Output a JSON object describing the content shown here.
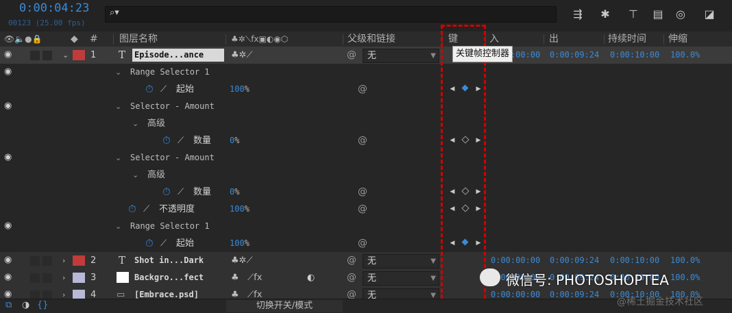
{
  "top": {
    "timecode": "0:00:04:23",
    "fps": "00123 (25.00 fps)",
    "search_placeholder": ""
  },
  "toolbar_icons": [
    "draft-3d-icon",
    "shape-icon",
    "frame-blend-icon",
    "graph-editor-icon",
    "motion-blur-icon",
    "composition-icon"
  ],
  "header": {
    "layer_name": "图层名称",
    "num": "#",
    "parent": "父级和链接",
    "key": "键",
    "in": "入",
    "out": "出",
    "duration": "持续时间",
    "stretch": "伸缩"
  },
  "tooltip": "关键帧控制器",
  "rows": [
    {
      "kind": "layer",
      "num": "1",
      "name": "Episode...ance",
      "color": "#c23b3b",
      "parent": "无",
      "in": "0:00:00:00",
      "out": "0:00:09:24",
      "dur": "0:00:10:00",
      "stretch": "100.0%"
    },
    {
      "kind": "group",
      "label": "Range Selector 1"
    },
    {
      "kind": "prop",
      "label": "起始",
      "value": "100",
      "unit": "%",
      "kf": "on"
    },
    {
      "kind": "group",
      "label": "Selector - Amount"
    },
    {
      "kind": "subgroup",
      "label": "高级"
    },
    {
      "kind": "prop",
      "label": "数量",
      "value": "0",
      "unit": "%",
      "kf": "off"
    },
    {
      "kind": "group",
      "label": "Selector - Amount"
    },
    {
      "kind": "subgroup",
      "label": "高级"
    },
    {
      "kind": "prop",
      "label": "数量",
      "value": "0",
      "unit": "%",
      "kf": "off"
    },
    {
      "kind": "prop",
      "label": "不透明度",
      "value": "100",
      "unit": "%",
      "kf": "off"
    },
    {
      "kind": "group",
      "label": "Range Selector 1"
    },
    {
      "kind": "prop",
      "label": "起始",
      "value": "100",
      "unit": "%",
      "kf": "on"
    },
    {
      "kind": "layer",
      "num": "2",
      "name": "Shot in...Dark",
      "color": "#c23b3b",
      "parent": "无",
      "in": "0:00:00:00",
      "out": "0:00:09:24",
      "dur": "0:00:10:00",
      "stretch": "100.0%"
    },
    {
      "kind": "layer",
      "num": "3",
      "name": "Backgro...fect",
      "color": "#b8b8d8",
      "parent": "无",
      "in": "0:00:00:00",
      "out": "0:00:09:24",
      "dur": "0:00:10:00",
      "stretch": "100.0%"
    },
    {
      "kind": "layer",
      "num": "4",
      "name": "[Embrace.psd]",
      "color": "#b8b8d8",
      "parent": "无",
      "in": "0:00:00:00",
      "out": "0:00:09:24",
      "dur": "0:00:10:00",
      "stretch": "100.0%"
    }
  ],
  "footer": {
    "mode_toggle": "切换开关/模式"
  },
  "watermark": {
    "text": "微信号: PHOTOSHOPTEA",
    "site": "@稀土掘金技术社区"
  },
  "colors": {
    "accent": "#3a8bd8",
    "highlight": "#d20000"
  }
}
